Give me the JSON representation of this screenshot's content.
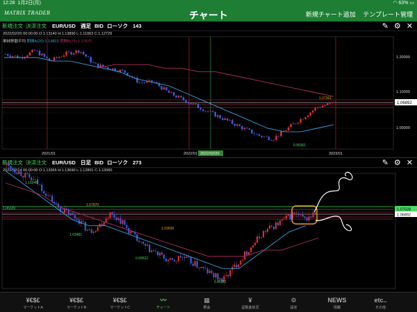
{
  "status": {
    "time": "12:28",
    "date": "1月2日(月)",
    "battery": "63%"
  },
  "header": {
    "logo": "MATRIX TRADER",
    "title": "チャート",
    "new_chart": "新規チャート追加",
    "template": "テンプレート管理"
  },
  "panel1": {
    "new_order": "新規注文",
    "settle_order": "決済注文",
    "pair": "EUR/USD",
    "timeframe": "週足",
    "price_type": "BID",
    "chart_type": "ローソク",
    "count": "143",
    "ohlc": "2022/02/20 00:00:00   O:1.13140   H:1.13890   L:1.11063   C:1.12729",
    "ma_label": "単純移動平均",
    "ma_a": "期間A(20):1.13823",
    "ma_b": "期間B(75):1.17875",
    "y_ticks": [
      "1.20000",
      "1.10000",
      "1.00000"
    ],
    "x_ticks": [
      "2021/01",
      "2022/01",
      "2023/01"
    ],
    "cursor_date": "2022/02/20",
    "price_tag": "1.06892",
    "low_label": "0.95361",
    "high_label": "1.07361"
  },
  "panel2": {
    "new_order": "新規注文",
    "settle_order": "決済注文",
    "pair": "EUR/USD",
    "timeframe": "日足",
    "price_type": "BID",
    "chart_type": "ローソク",
    "count": "273",
    "ohlc": "2022/02/14 00:00:00   O:1.13365   H:1.13690   L:1.12801   C:1.13060",
    "price_tag_1": "1.07528",
    "price_tag_2": "1.06892",
    "left_level": "1.05329",
    "annotations": [
      "1.15048",
      "1.07870",
      "1.03481",
      "1.03698",
      "0.99522",
      "0.95361"
    ]
  },
  "tabs": [
    {
      "icon": "¥€$£",
      "label": "マーケットA",
      "icon_name": "currency-icon"
    },
    {
      "icon": "¥€$£",
      "label": "マーケットB",
      "icon_name": "currency-icon"
    },
    {
      "icon": "¥€$£",
      "label": "マーケットC",
      "icon_name": "currency-icon"
    },
    {
      "icon": "〰",
      "label": "チャート",
      "icon_name": "chart-icon",
      "active": true
    },
    {
      "icon": "▦",
      "label": "照会",
      "icon_name": "search-icon"
    },
    {
      "icon": "¥",
      "label": "証拠金状況",
      "icon_name": "margin-icon"
    },
    {
      "icon": "⚙",
      "label": "設定",
      "icon_name": "settings-icon"
    },
    {
      "icon": "NEWS",
      "label": "情報",
      "icon_name": "news-icon"
    },
    {
      "icon": "etc..",
      "label": "その他",
      "icon_name": "more-icon"
    }
  ],
  "colors": {
    "header_green": "#1e7e34",
    "up_candle": "#e03030",
    "down_candle": "#3a5fe0",
    "ma_a": "#3aa0e0",
    "ma_b": "#b03060",
    "price_tag_green": "#4cd964",
    "highlight_orange": "#f0a020"
  },
  "chart_data": [
    {
      "type": "candlestick",
      "title": "EUR/USD 週足",
      "y_ticks": [
        1.2,
        1.1,
        1.0
      ],
      "ylim": [
        0.92,
        1.25
      ],
      "x_ticks": [
        "2021/01",
        "2022/01",
        "2023/01"
      ],
      "close_path": [
        1.21,
        1.2,
        1.22,
        1.19,
        1.21,
        1.22,
        1.18,
        1.17,
        1.16,
        1.13,
        1.13,
        1.1,
        1.08,
        1.06,
        1.04,
        1.02,
        1.0,
        0.98,
        0.97,
        1.0,
        1.03,
        1.06,
        1.07
      ],
      "ma_a": [
        1.2,
        1.2,
        1.2,
        1.19,
        1.19,
        1.18,
        1.17,
        1.16,
        1.14,
        1.13,
        1.12,
        1.1,
        1.08,
        1.06,
        1.04,
        1.02,
        1.0,
        0.99,
        0.99,
        1.0,
        1.01
      ],
      "ma_b": [
        1.17,
        1.18,
        1.18,
        1.18,
        1.17,
        1.17,
        1.16,
        1.16,
        1.15,
        1.14,
        1.13,
        1.12,
        1.11,
        1.1,
        1.09
      ],
      "latest": 1.06892,
      "low": 0.95361
    },
    {
      "type": "candlestick",
      "title": "EUR/USD 日足",
      "annotations": [
        1.15048,
        1.0787,
        1.03481,
        1.03698,
        0.99522,
        0.95361
      ],
      "latest": 1.06892,
      "marked_price": 1.07528,
      "left_level": 1.05329
    }
  ]
}
